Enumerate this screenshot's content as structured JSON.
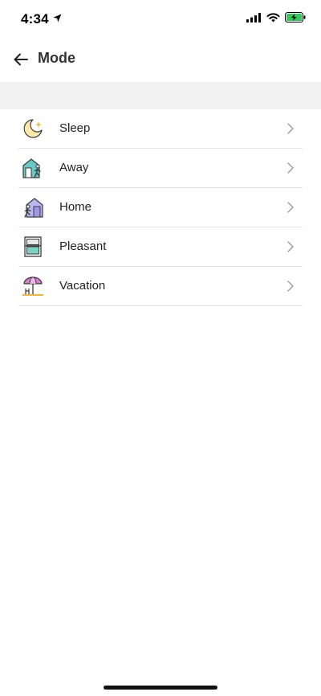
{
  "status": {
    "time": "4:34"
  },
  "header": {
    "title": "Mode"
  },
  "modes": [
    {
      "label": "Sleep",
      "icon": "moon-star-icon"
    },
    {
      "label": "Away",
      "icon": "house-walking-out-icon"
    },
    {
      "label": "Home",
      "icon": "house-walking-in-icon"
    },
    {
      "label": "Pleasant",
      "icon": "window-icon"
    },
    {
      "label": "Vacation",
      "icon": "beach-umbrella-icon"
    }
  ],
  "colors": {
    "sleep_accent": "#f2b531",
    "away_accent": "#69c7c6",
    "home_accent": "#9c98e6",
    "pleasant_accent": "#7fd1c4",
    "vacation_accent": "#d97bd0",
    "battery_green": "#34c759"
  }
}
